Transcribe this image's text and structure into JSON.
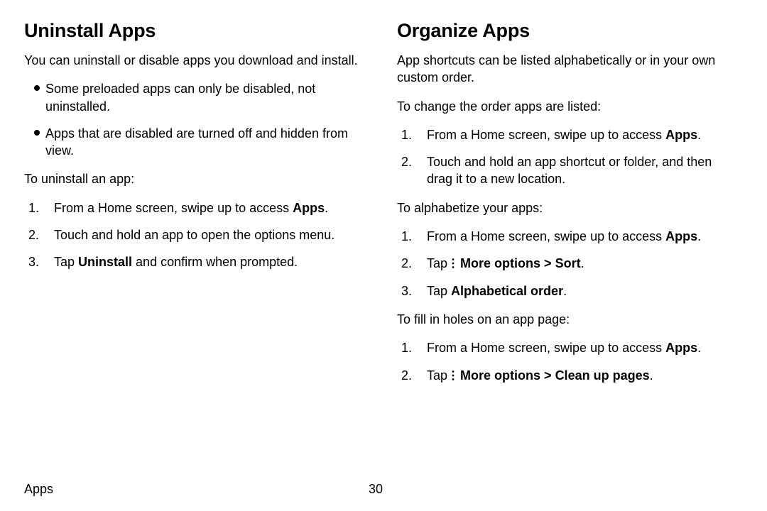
{
  "left": {
    "title": "Uninstall Apps",
    "intro": "You can uninstall or disable apps you download and install.",
    "bullets": [
      "Some preloaded apps can only be disabled, not uninstalled.",
      "Apps that are disabled are turned off and hidden from view."
    ],
    "lead1": "To uninstall an app:",
    "steps1": {
      "s1_pre": "From a Home screen, swipe up to access ",
      "s1_bold": "Apps",
      "s1_post": ".",
      "s2": "Touch and hold an app to open the options menu.",
      "s3_pre": "Tap ",
      "s3_bold": "Uninstall",
      "s3_post": " and confirm when prompted."
    }
  },
  "right": {
    "title": "Organize Apps",
    "intro": "App shortcuts can be listed alphabetically or in your own custom order.",
    "lead1": "To change the order apps are listed:",
    "steps1": {
      "s1_pre": "From a Home screen, swipe up to access ",
      "s1_bold": "Apps",
      "s1_post": ".",
      "s2": "Touch and hold an app shortcut or folder, and then drag it to a new location."
    },
    "lead2": "To alphabetize your apps:",
    "steps2": {
      "s1_pre": "From a Home screen, swipe up to access ",
      "s1_bold": "Apps",
      "s1_post": ".",
      "s2_pre": "Tap ",
      "s2_bold1": "More options",
      "s2_mid": " > ",
      "s2_bold2": "Sort",
      "s2_post": ".",
      "s3_pre": "Tap ",
      "s3_bold": "Alphabetical order",
      "s3_post": "."
    },
    "lead3": "To fill in holes on an app page:",
    "steps3": {
      "s1_pre": "From a Home screen, swipe up to access ",
      "s1_bold": "Apps",
      "s1_post": ".",
      "s2_pre": "Tap ",
      "s2_bold1": "More options",
      "s2_mid": " > ",
      "s2_bold2": "Clean up pages",
      "s2_post": "."
    }
  },
  "footer": {
    "section": "Apps",
    "page": "30"
  }
}
